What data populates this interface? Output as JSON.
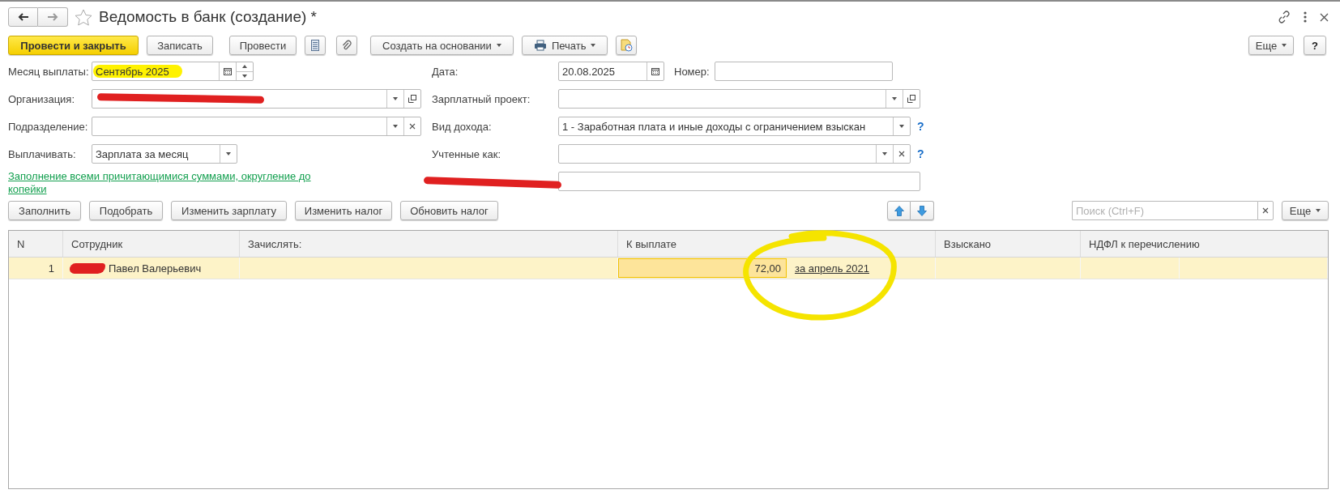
{
  "window": {
    "title": "Ведомость в банк (создание) *",
    "favorite": false
  },
  "toolbar": {
    "buttons": [
      {
        "label": "Провести и закрыть",
        "kind": "primary"
      },
      {
        "label": "Записать",
        "kind": "plain"
      },
      {
        "label": "Провести",
        "kind": "plain"
      },
      {
        "kind": "sheet"
      },
      {
        "kind": "clip"
      },
      {
        "label": "Создать на основании",
        "kind": "menu"
      },
      {
        "label": "Печать",
        "kind": "print"
      },
      {
        "kind": "report"
      }
    ],
    "more": "Еще",
    "help": "?"
  },
  "form": {
    "left": [
      {
        "label": "Месяц выплаты:",
        "value": "Сентябрь 2025",
        "kind": "month",
        "highlighted": true
      },
      {
        "label": "Организация:",
        "kind": "choice-open",
        "redacted": true
      },
      {
        "label": "Подразделение:",
        "kind": "choice-clear"
      },
      {
        "label": "Выплачивать:",
        "value": "Зарплата за месяц",
        "kind": "choice"
      }
    ],
    "link": "Заполнение всеми причитающимися суммами, округление до копейки",
    "right": [
      {
        "label": "Дата:",
        "value": "20.08.2025",
        "kind": "date",
        "extra": {
          "label": "Номер:",
          "kind": "text"
        }
      },
      {
        "label": "Зарплатный проект:",
        "kind": "choice-open"
      },
      {
        "label": "Вид дохода:",
        "value": "1 - Заработная плата и иные доходы с ограничением взыскан",
        "kind": "choice",
        "help": "?"
      },
      {
        "label": "Учтенные как:",
        "kind": "choice-clear",
        "help": "?"
      },
      {
        "kind": "text",
        "redacted": true
      }
    ]
  },
  "table_bar": {
    "buttons": [
      "Заполнить",
      "Подобрать",
      "Изменить зарплату",
      "Изменить налог",
      "Обновить налог"
    ],
    "search": {
      "placeholder": "Поиск (Ctrl+F)"
    },
    "more": "Еще"
  },
  "table": {
    "columns": [
      "N",
      "Сотрудник",
      "Зачислять:",
      "К выплате",
      "Взыскано",
      "НДФЛ к перечислению"
    ],
    "rows": [
      {
        "n": "1",
        "employee": "Павел Валерьевич",
        "employee_redacted": true,
        "amount": "72,00",
        "period": "за апрель 2021",
        "selected": true,
        "circled": true
      }
    ]
  }
}
